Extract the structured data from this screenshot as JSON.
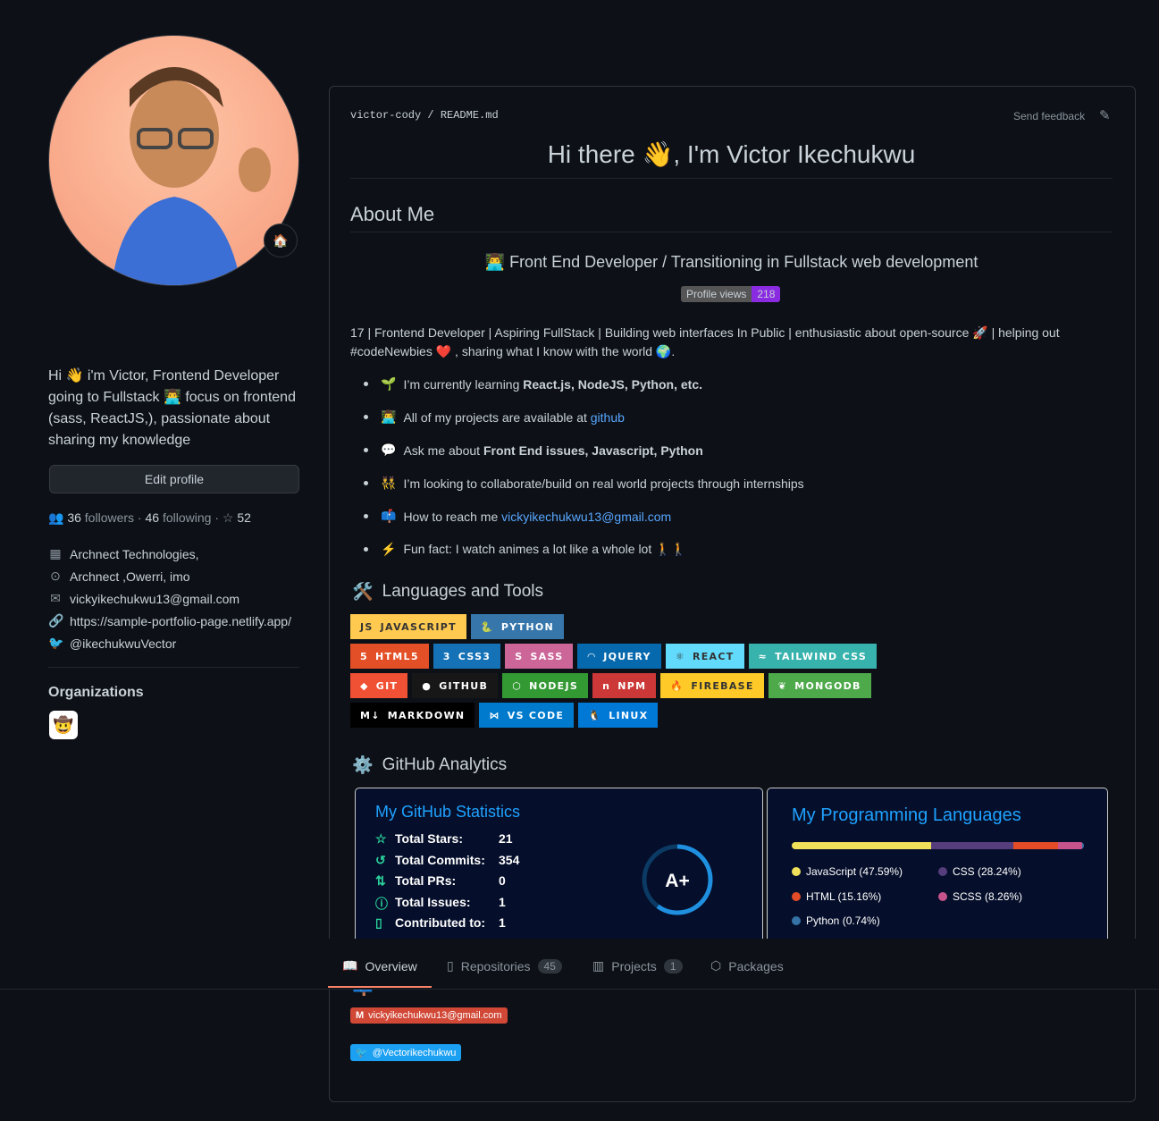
{
  "sidebar": {
    "status_emoji": "🏠",
    "bio": "Hi 👋 i'm Victor, Frontend Developer going to Fullstack 👨‍💻 focus on frontend (sass, ReactJS,), passionate about sharing my knowledge",
    "edit_profile": "Edit profile",
    "followers": "36",
    "followers_label": "followers",
    "following": "46",
    "following_label": "following",
    "stars": "52",
    "company": "Archnect Technologies,",
    "location": "Archnect ,Owerri, imo",
    "email": "vickyikechukwu13@gmail.com",
    "website": "https://sample-portfolio-page.netlify.app/",
    "twitter": "@ikechukwuVector",
    "organizations_title": "Organizations"
  },
  "readme": {
    "owner": "victor-cody",
    "file": "README.md",
    "send_feedback": "Send feedback",
    "title": "Hi there 👋, I'm Victor Ikechukwu",
    "about_title": "About Me",
    "subtitle": "👨‍💻 Front End Developer / Transitioning in Fullstack web development",
    "profile_views_label": "Profile views",
    "profile_views": "218",
    "intro": "17 | Frontend Developer | Aspiring FullStack | Building web interfaces In Public | enthusiastic about open-source 🚀 | helping out #codeNewbies ❤️ , sharing what I know with the world 🌍.",
    "bullets": [
      {
        "emoji": "🌱",
        "text": "I’m currently learning ",
        "bold": "React.js, NodeJS, Python, etc."
      },
      {
        "emoji": "👨‍💻",
        "text": "All of my projects are available at ",
        "link": "github"
      },
      {
        "emoji": "💬",
        "text": "Ask me about ",
        "bold": "Front End issues, Javascript, Python"
      },
      {
        "emoji": "👯",
        "text": "I’m looking to collaborate/build on real world projects through internships"
      },
      {
        "emoji": "📫",
        "text": "How to reach me ",
        "link": "vickyikechukwu13@gmail.com"
      },
      {
        "emoji": "⚡",
        "text": "Fun fact: I watch animes a lot like a whole lot 🚶🚶"
      }
    ],
    "tools_title": "Languages and Tools",
    "badges": [
      [
        {
          "label": "JAVASCRIPT",
          "color": "#ffca4f",
          "fg": "#333",
          "icon": "JS"
        },
        {
          "label": "PYTHON",
          "color": "#3776ab",
          "fg": "#fff",
          "icon": "🐍"
        }
      ],
      [
        {
          "label": "HTML5",
          "color": "#e34f26",
          "fg": "#fff",
          "icon": "5"
        },
        {
          "label": "CSS3",
          "color": "#1572b6",
          "fg": "#fff",
          "icon": "3"
        },
        {
          "label": "SASS",
          "color": "#cc6699",
          "fg": "#fff",
          "icon": "S"
        },
        {
          "label": "JQUERY",
          "color": "#0769ad",
          "fg": "#fff",
          "icon": "◠"
        },
        {
          "label": "REACT",
          "color": "#61dafb",
          "fg": "#333",
          "icon": "⚛"
        },
        {
          "label": "TAILWIND CSS",
          "color": "#38b2ac",
          "fg": "#fff",
          "icon": "≈"
        }
      ],
      [
        {
          "label": "GIT",
          "color": "#f05033",
          "fg": "#fff",
          "icon": "◆"
        },
        {
          "label": "GITHUB",
          "color": "#181717",
          "fg": "#fff",
          "icon": "●"
        },
        {
          "label": "NODEJS",
          "color": "#339933",
          "fg": "#fff",
          "icon": "⬡"
        },
        {
          "label": "NPM",
          "color": "#cb3837",
          "fg": "#fff",
          "icon": "n"
        },
        {
          "label": "FIREBASE",
          "color": "#ffca28",
          "fg": "#333",
          "icon": "🔥"
        },
        {
          "label": "MONGODB",
          "color": "#4ea94b",
          "fg": "#fff",
          "icon": "❦"
        }
      ],
      [
        {
          "label": "MARKDOWN",
          "color": "#000000",
          "fg": "#fff",
          "icon": "M↓"
        },
        {
          "label": "VS CODE",
          "color": "#007acc",
          "fg": "#fff",
          "icon": "⋈"
        },
        {
          "label": "LINUX",
          "color": "#0078d6",
          "fg": "#fff",
          "icon": "🐧"
        }
      ]
    ],
    "analytics_title": "GitHub Analytics",
    "stats": {
      "title": "My GitHub Statistics",
      "rows": [
        {
          "label": "Total Stars:",
          "value": "21",
          "icon": "☆"
        },
        {
          "label": "Total Commits:",
          "value": "354",
          "icon": "↺"
        },
        {
          "label": "Total PRs:",
          "value": "0",
          "icon": "⇅"
        },
        {
          "label": "Total Issues:",
          "value": "1",
          "icon": "ⓘ"
        },
        {
          "label": "Contributed to:",
          "value": "1",
          "icon": "▯"
        }
      ],
      "grade": "A+",
      "grade_progress": 0.6
    },
    "languages": {
      "title": "My Programming Languages",
      "items": [
        {
          "name": "JavaScript (47.59%)",
          "pct": 47.59,
          "color": "#f1e05a"
        },
        {
          "name": "CSS (28.24%)",
          "pct": 28.24,
          "color": "#563d7c"
        },
        {
          "name": "HTML (15.16%)",
          "pct": 15.16,
          "color": "#e34c26"
        },
        {
          "name": "SCSS (8.26%)",
          "pct": 8.26,
          "color": "#c6538c"
        },
        {
          "name": "Python (0.74%)",
          "pct": 0.74,
          "color": "#3572a5"
        }
      ]
    },
    "connect": {
      "email": "vickyikechukwu13@gmail.com",
      "twitter": "@Vectorikechukwu"
    }
  },
  "tabs": [
    {
      "label": "Overview"
    },
    {
      "label": "Repositories",
      "count": "45"
    },
    {
      "label": "Projects",
      "count": "1"
    },
    {
      "label": "Packages"
    }
  ]
}
